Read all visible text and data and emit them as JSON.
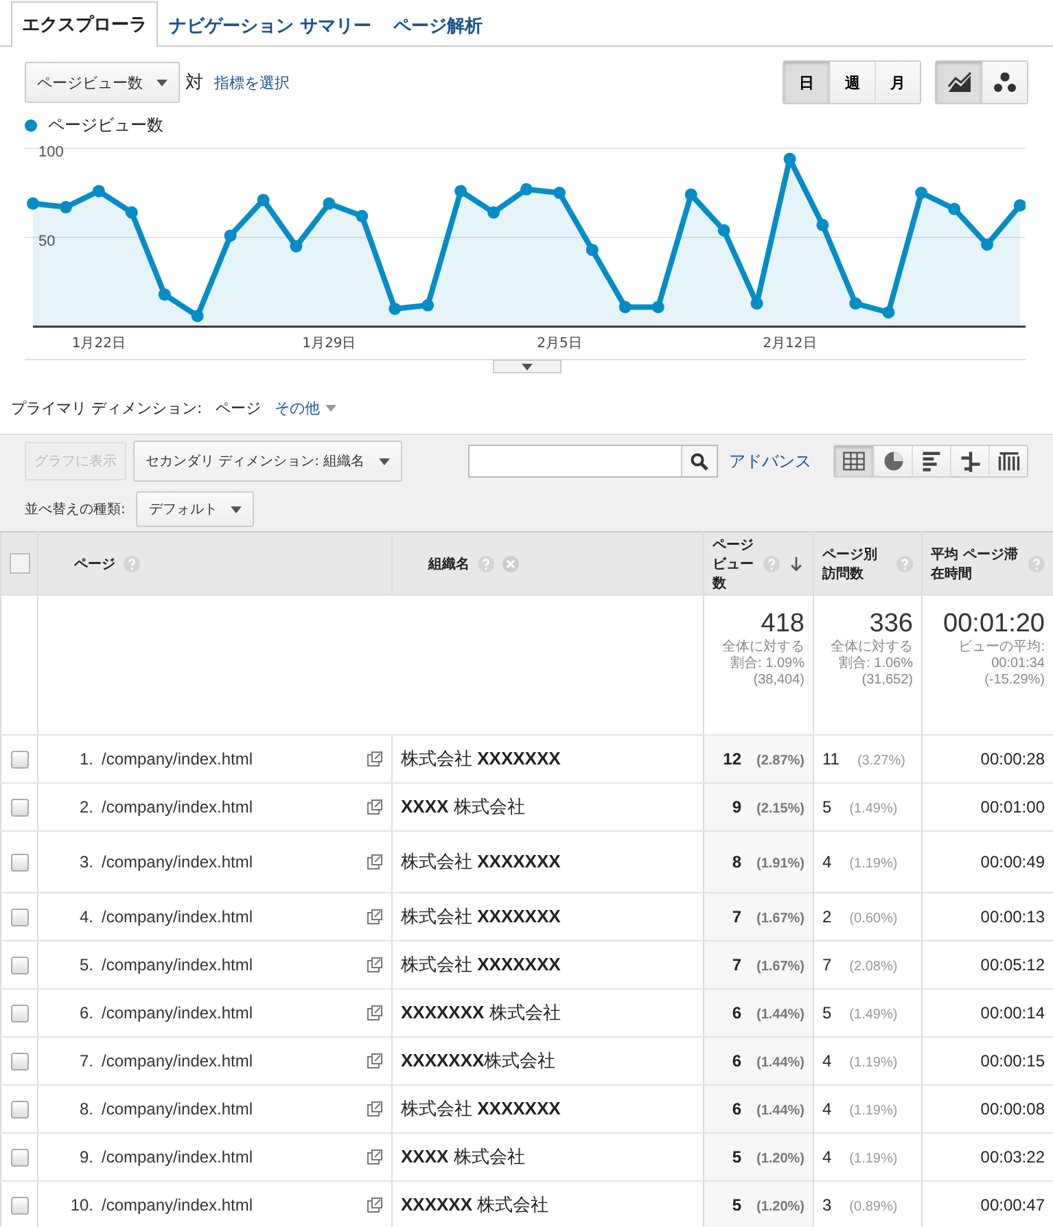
{
  "tabs": [
    {
      "label": "エクスプローラ",
      "selected": true
    },
    {
      "label": "ナビゲーション サマリー",
      "selected": false
    },
    {
      "label": "ページ解析",
      "selected": false
    }
  ],
  "metric_selector": {
    "value": "ページビュー数",
    "versus": "対",
    "link": "指標を選択"
  },
  "period_buttons": [
    {
      "label": "日",
      "selected": true
    },
    {
      "label": "週",
      "selected": false
    },
    {
      "label": "月",
      "selected": false
    }
  ],
  "chart_type_buttons": [
    {
      "kind": "line",
      "selected": true
    },
    {
      "kind": "motion",
      "selected": false
    }
  ],
  "chart": {
    "chart_data": {
      "type": "area",
      "categories": [
        null,
        null,
        "1月22日",
        null,
        null,
        null,
        null,
        null,
        null,
        "1月29日",
        null,
        null,
        null,
        null,
        null,
        null,
        "2月5日",
        null,
        null,
        null,
        null,
        null,
        null,
        "2月12日",
        null,
        null,
        null,
        null,
        null,
        null,
        null
      ],
      "series": [
        {
          "name": "ページビュー数",
          "color": "#058dc7",
          "values": [
            69,
            67,
            76,
            64,
            18,
            6,
            51,
            71,
            45,
            69,
            62,
            10,
            12,
            76,
            64,
            77,
            75,
            43,
            11,
            11,
            74,
            54,
            13,
            94,
            57,
            13,
            8,
            75,
            66,
            46,
            68
          ]
        }
      ],
      "ylim": [
        0,
        100
      ],
      "yticks": [
        50,
        100
      ]
    }
  },
  "dimension": {
    "label": "プライマリ ディメンション:",
    "current": "ページ",
    "other": "その他"
  },
  "toolbar": {
    "plot_button": {
      "label": "グラフに表示",
      "disabled": true
    },
    "secondary_dimension": "セカンダリ ディメンション: 組織名",
    "advanced": "アドバンス",
    "sort_label": "並べ替えの種類:",
    "sort_value": "デフォルト",
    "views": [
      {
        "kind": "table",
        "selected": true
      },
      {
        "kind": "pie",
        "selected": false
      },
      {
        "kind": "bars",
        "selected": false
      },
      {
        "kind": "compare",
        "selected": false
      },
      {
        "kind": "pivot",
        "selected": false
      }
    ]
  },
  "table": {
    "all_checked": false,
    "columns": [
      {
        "label": "ページ",
        "help": true,
        "removable": false,
        "sorted": false
      },
      {
        "label": "組織名",
        "help": true,
        "removable": true,
        "sorted": false
      },
      {
        "label": "ページビュー数",
        "help": true,
        "removable": false,
        "sorted": true
      },
      {
        "label": "ページ別訪問数",
        "help": true,
        "removable": false,
        "sorted": false
      },
      {
        "label": "平均 ページ滞在時間",
        "help": true,
        "removable": false,
        "sorted": false
      }
    ],
    "totals": [
      {
        "value": "418",
        "note": "全体に対する割合: 1.09% (38,404)"
      },
      {
        "value": "336",
        "note": "全体に対する割合: 1.06% (31,652)"
      },
      {
        "value": "00:01:20",
        "note": "ビューの平均: 00:01:34 (-15.29%)"
      }
    ],
    "rows": [
      {
        "index": "1.",
        "page": "/company/index.html",
        "org": "株式会社 **XXXXXXX**",
        "views": "12",
        "views_pct": "(2.87%)",
        "visits": "11",
        "visits_pct": "(3.27%)",
        "time": "00:00:28",
        "checked": false
      },
      {
        "index": "2.",
        "page": "/company/index.html",
        "org": "**XXXX** 株式会社",
        "views": "9",
        "views_pct": "(2.15%)",
        "visits": "5",
        "visits_pct": "(1.49%)",
        "time": "00:01:00",
        "checked": false
      },
      {
        "index": "3.",
        "page": "/company/index.html",
        "org": "株式会社 **XXXXXXX**",
        "views": "8",
        "views_pct": "(1.91%)",
        "visits": "4",
        "visits_pct": "(1.19%)",
        "time": "00:00:49",
        "checked": false
      },
      {
        "index": "4.",
        "page": "/company/index.html",
        "org": "株式会社 **XXXXXXX**",
        "views": "7",
        "views_pct": "(1.67%)",
        "visits": "2",
        "visits_pct": "(0.60%)",
        "time": "00:00:13",
        "checked": false
      },
      {
        "index": "5.",
        "page": "/company/index.html",
        "org": "株式会社 **XXXXXXX**",
        "views": "7",
        "views_pct": "(1.67%)",
        "visits": "7",
        "visits_pct": "(2.08%)",
        "time": "00:05:12",
        "checked": false
      },
      {
        "index": "6.",
        "page": "/company/index.html",
        "org": "**XXXXXXX** 株式会社",
        "views": "6",
        "views_pct": "(1.44%)",
        "visits": "5",
        "visits_pct": "(1.49%)",
        "time": "00:00:14",
        "checked": false
      },
      {
        "index": "7.",
        "page": "/company/index.html",
        "org": "**XXXXXXX**株式会社",
        "views": "6",
        "views_pct": "(1.44%)",
        "visits": "4",
        "visits_pct": "(1.19%)",
        "time": "00:00:15",
        "checked": false
      },
      {
        "index": "8.",
        "page": "/company/index.html",
        "org": "株式会社 **XXXXXXX**",
        "views": "6",
        "views_pct": "(1.44%)",
        "visits": "4",
        "visits_pct": "(1.19%)",
        "time": "00:00:08",
        "checked": false
      },
      {
        "index": "9.",
        "page": "/company/index.html",
        "org": "**XXXX** 株式会社",
        "views": "5",
        "views_pct": "(1.20%)",
        "visits": "4",
        "visits_pct": "(1.19%)",
        "time": "00:03:22",
        "checked": false
      },
      {
        "index": "10.",
        "page": "/company/index.html",
        "org": "**XXXXXX** 株式会社",
        "views": "5",
        "views_pct": "(1.20%)",
        "visits": "3",
        "visits_pct": "(0.89%)",
        "time": "00:00:47",
        "checked": false
      }
    ]
  }
}
